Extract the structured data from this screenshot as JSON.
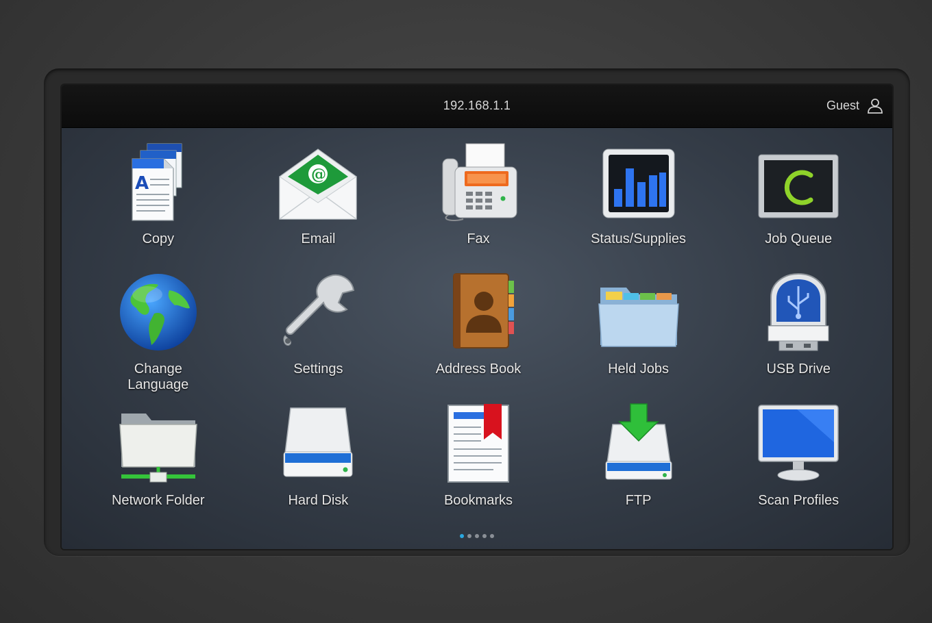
{
  "header": {
    "address": "192.168.1.1",
    "user_label": "Guest",
    "user_icon": "user-icon"
  },
  "apps": [
    {
      "id": "copy",
      "label": "Copy",
      "icon": "copy-icon"
    },
    {
      "id": "email",
      "label": "Email",
      "icon": "email-icon"
    },
    {
      "id": "fax",
      "label": "Fax",
      "icon": "fax-icon"
    },
    {
      "id": "status-supplies",
      "label": "Status/Supplies",
      "icon": "status-chart-icon"
    },
    {
      "id": "job-queue",
      "label": "Job Queue",
      "icon": "job-queue-icon"
    },
    {
      "id": "change-language",
      "label": "Change\nLanguage",
      "icon": "globe-icon"
    },
    {
      "id": "settings",
      "label": "Settings",
      "icon": "wrench-icon"
    },
    {
      "id": "address-book",
      "label": "Address Book",
      "icon": "address-book-icon"
    },
    {
      "id": "held-jobs",
      "label": "Held Jobs",
      "icon": "folder-icon"
    },
    {
      "id": "usb-drive",
      "label": "USB Drive",
      "icon": "usb-drive-icon"
    },
    {
      "id": "network-folder",
      "label": "Network Folder",
      "icon": "network-folder-icon"
    },
    {
      "id": "hard-disk",
      "label": "Hard Disk",
      "icon": "hard-disk-icon"
    },
    {
      "id": "bookmarks",
      "label": "Bookmarks",
      "icon": "bookmark-icon"
    },
    {
      "id": "ftp",
      "label": "FTP",
      "icon": "ftp-icon"
    },
    {
      "id": "scan-profiles",
      "label": "Scan Profiles",
      "icon": "monitor-icon"
    }
  ],
  "pager": {
    "pages": 5,
    "current": 1
  },
  "colors": {
    "active_dot": "#2aa8e0",
    "inactive_dot": "#8a8f96",
    "accent_green": "#1e9a3a",
    "accent_blue": "#1f6fd6"
  }
}
